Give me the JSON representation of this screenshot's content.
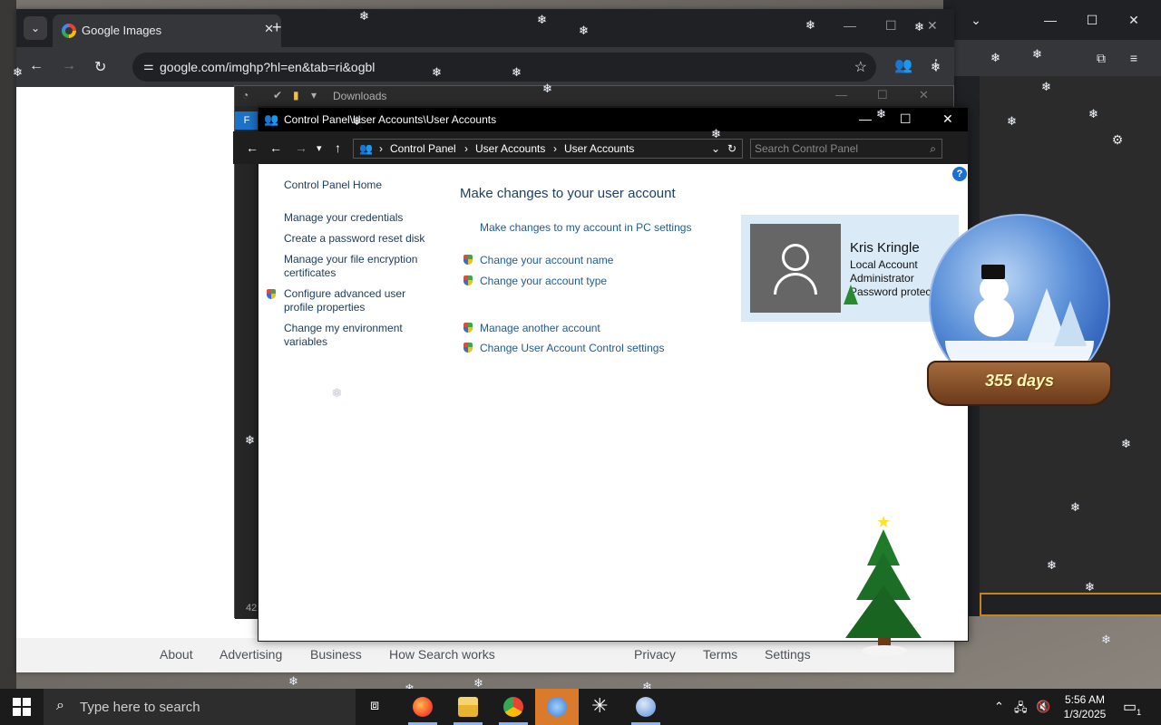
{
  "chrome": {
    "tab_title": "Google Images",
    "url": "google.com/imghp?hl=en&tab=ri&ogbl",
    "footer_links": [
      "About",
      "Advertising",
      "Business",
      "How Search works",
      "Privacy",
      "Terms",
      "Settings"
    ]
  },
  "downloads": {
    "title": "Downloads",
    "tab_letter": "F",
    "count": "42"
  },
  "control_panel": {
    "window_title": "Control Panel\\User Accounts\\User Accounts",
    "breadcrumb": [
      "Control Panel",
      "User Accounts",
      "User Accounts"
    ],
    "search_placeholder": "Search Control Panel",
    "side_home": "Control Panel Home",
    "side_links": [
      "Manage your credentials",
      "Create a password reset disk",
      "Manage your file encryption certificates",
      "Configure advanced user profile properties",
      "Change my environment variables"
    ],
    "main_title": "Make changes to your user account",
    "links": [
      "Make changes to my account in PC settings",
      "Change your account name",
      "Change your account type",
      "Manage another account",
      "Change User Account Control settings"
    ],
    "account": {
      "name": "Kris Kringle",
      "type": "Local Account",
      "role": "Administrator",
      "status": "Password protected"
    }
  },
  "overlay": {
    "countdown": "355 days"
  },
  "taskbar": {
    "search_placeholder": "Type here to search",
    "time": "5:56 AM",
    "date": "1/3/2025",
    "notification_count": "1"
  }
}
